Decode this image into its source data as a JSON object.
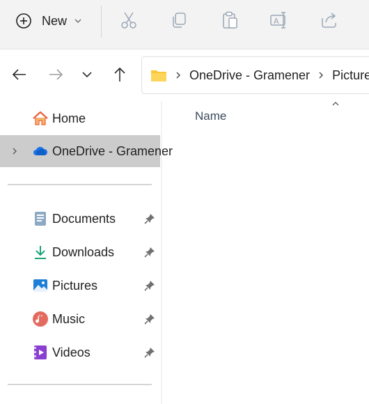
{
  "toolbar": {
    "new_label": "New",
    "icons": [
      "cut-icon",
      "copy-icon",
      "paste-icon",
      "rename-icon",
      "share-icon"
    ]
  },
  "navigation": {
    "buttons": [
      "back-arrow-icon",
      "forward-arrow-icon",
      "recent-dropdown-icon",
      "up-arrow-icon"
    ]
  },
  "address_bar": {
    "crumbs": [
      "OneDrive - Gramener",
      "Pictures"
    ]
  },
  "sidebar": {
    "home": "Home",
    "onedrive": "OneDrive - Gramener",
    "quick_access": [
      {
        "label": "Documents",
        "icon": "documents-icon"
      },
      {
        "label": "Downloads",
        "icon": "downloads-icon"
      },
      {
        "label": "Pictures",
        "icon": "pictures-icon"
      },
      {
        "label": "Music",
        "icon": "music-icon"
      },
      {
        "label": "Videos",
        "icon": "videos-icon"
      }
    ]
  },
  "content": {
    "column_name": "Name"
  },
  "colors": {
    "toolbar_bg": "#f3f3f3",
    "selected_bg": "#cccccc",
    "accent": "#0067c0"
  }
}
